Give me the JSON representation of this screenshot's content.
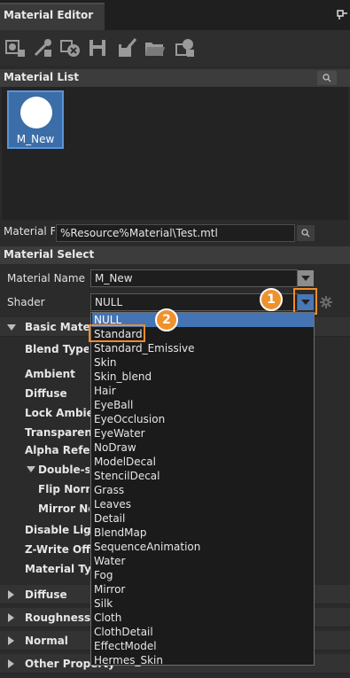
{
  "window": {
    "title": "Material Editor",
    "pin_icon": "pin-icon"
  },
  "toolbar": {
    "buttons": [
      {
        "name": "create-material-icon"
      },
      {
        "name": "pick-material-icon"
      },
      {
        "name": "delete-material-icon"
      },
      {
        "name": "save-icon"
      },
      {
        "name": "save-as-icon"
      },
      {
        "name": "open-folder-icon"
      },
      {
        "name": "apply-material-icon"
      }
    ]
  },
  "material_list": {
    "header": "Material List",
    "items": [
      {
        "label": "M_New"
      }
    ]
  },
  "material_file": {
    "label": "Material F",
    "value": "%Resource%Material\\Test.mtl"
  },
  "material_select": {
    "header": "Material Select",
    "name_label": "Material Name",
    "name_value": "M_New",
    "shader_label": "Shader",
    "shader_value": "NULL"
  },
  "shader_dropdown": {
    "options": [
      "NULL",
      "Standard",
      "Standard_Emissive",
      "Skin",
      "Skin_blend",
      "Hair",
      "EyeBall",
      "EyeOcclusion",
      "EyeWater",
      "NoDraw",
      "ModelDecal",
      "StencilDecal",
      "Grass",
      "Leaves",
      "Detail",
      "BlendMap",
      "SequenceAnimation",
      "Water",
      "Fog",
      "Mirror",
      "Silk",
      "Cloth",
      "ClothDetail",
      "EffectModel",
      "Hermes_Skin"
    ],
    "selected": "NULL",
    "highlighted": "Standard"
  },
  "callouts": [
    "1",
    "2"
  ],
  "colors": {
    "accent": "#4574b4",
    "callout": "#f0922c",
    "highlight_border": "#f08c2c"
  },
  "basic_material": {
    "header": "Basic Materi",
    "props": [
      {
        "label": "Blend Type"
      },
      {
        "label": "Ambient"
      },
      {
        "label": "Diffuse"
      },
      {
        "label": "Lock Ambien"
      },
      {
        "label": "Transparency"
      },
      {
        "label": "Alpha Refere"
      },
      {
        "label": "Double-sid"
      },
      {
        "label": "Flip Norm"
      },
      {
        "label": "Mirror Nor"
      },
      {
        "label": "Disable Light"
      },
      {
        "label": "Z-Write Off"
      },
      {
        "label": "Material Typ"
      }
    ]
  },
  "sections": [
    "Diffuse",
    "Roughness",
    "Normal",
    "Other Property"
  ]
}
